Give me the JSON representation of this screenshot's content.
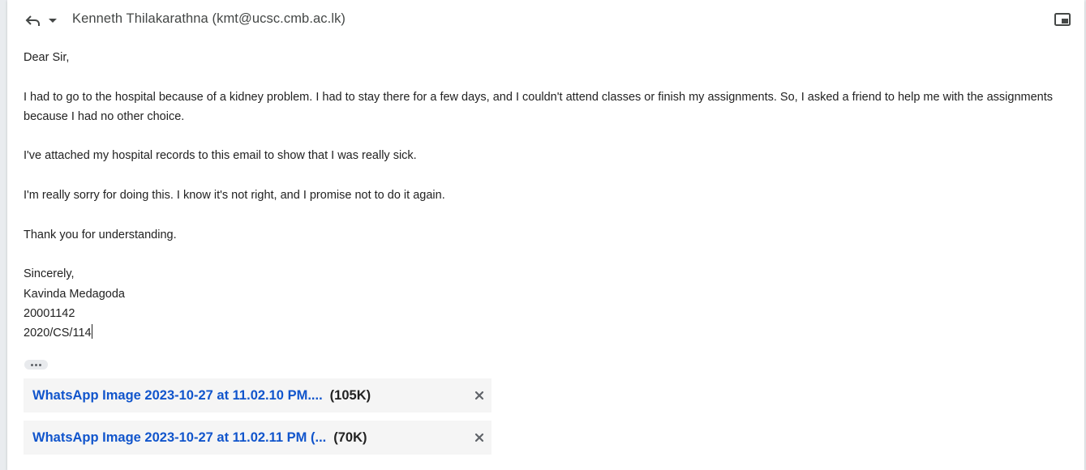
{
  "header": {
    "recipient": "Kenneth Thilakarathna (kmt@ucsc.cmb.ac.lk)",
    "reply_icon": "reply-icon",
    "dropdown_icon": "caret-down-icon",
    "popout_icon": "popout-icon"
  },
  "message": {
    "greeting": "Dear Sir,",
    "paragraph1": "I had to go to the hospital because of a kidney problem. I had to stay there for a few days, and I couldn't attend classes or finish my assignments. So, I asked a friend to help me with the assignments because I had no other choice.",
    "paragraph2": "I've attached my hospital records to this email to show that I was really sick.",
    "paragraph3": "I'm really sorry for doing this. I know it's not right, and I promise not to do it again.",
    "paragraph4": "Thank you for understanding.",
    "closing": "Sincerely,",
    "name": "Kavinda Medagoda",
    "student_no": "20001142",
    "index_no": "2020/CS/114"
  },
  "trimmed_content_icon": "more-horizontal-icon",
  "attachments": [
    {
      "name": "WhatsApp Image 2023-10-27 at 11.02.10 PM....",
      "size": "(105K)"
    },
    {
      "name": "WhatsApp Image 2023-10-27 at 11.02.11 PM (...",
      "size": "(70K)"
    }
  ],
  "colors": {
    "link": "#1155cc",
    "text": "#222222",
    "attachment_bg": "#f5f5f5"
  }
}
